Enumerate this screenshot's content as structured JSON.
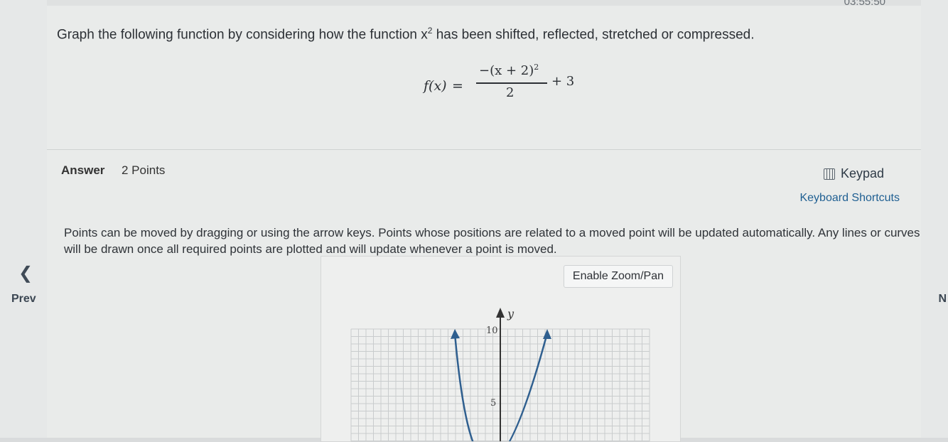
{
  "nav": {
    "prev_label": "Prev",
    "next_label": "N"
  },
  "timer": "03:55:50",
  "question": {
    "prompt_before": "Graph the following function by considering how the function x",
    "prompt_sup": "2",
    "prompt_after": " has been shifted, reflected, stretched or compressed.",
    "formula": {
      "lhs": "f(x)",
      "equals": "=",
      "numerator": "−(x + 2)",
      "numerator_sup": "2",
      "denominator": "2",
      "addend": "+ 3"
    }
  },
  "answer": {
    "label": "Answer",
    "points": "2 Points"
  },
  "tools": {
    "keypad_label": "Keypad",
    "shortcuts_label": "Keyboard Shortcuts"
  },
  "instructions": "Points can be moved by dragging or using the arrow keys. Points whose positions are related to a moved point will be updated automatically. Any lines or curves will be drawn once all required points are plotted and will update whenever a point is moved.",
  "graph": {
    "zoom_button": "Enable Zoom/Pan",
    "y_axis_label": "y",
    "tick_10": "10",
    "tick_5": "5",
    "curve_color": "#2f5f8f"
  }
}
